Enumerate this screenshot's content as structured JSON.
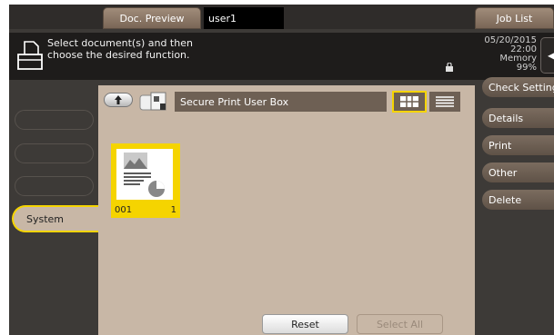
{
  "topbar": {
    "doc_preview_label": "Doc. Preview",
    "user_value": "user1",
    "job_list_label": "Job List"
  },
  "message": {
    "line1": "Select document(s) and then",
    "line2": "choose the desired function.",
    "date": "05/20/2015",
    "time": "22:00",
    "memory_label": "Memory",
    "memory_value": "99%"
  },
  "left_tabs": {
    "system_label": "System"
  },
  "main": {
    "box_title": "Secure Print User Box",
    "documents": [
      {
        "name": "001",
        "count": "1"
      }
    ],
    "reset_label": "Reset",
    "select_all_label": "Select All"
  },
  "right_menu": {
    "check_setting": "Check Setting",
    "details": "Details",
    "print": "Print",
    "other": "Other",
    "delete": "Delete"
  },
  "colors": {
    "accent": "#f5d400",
    "panel": "#c8b7a6",
    "frame": "#3d3a37"
  }
}
